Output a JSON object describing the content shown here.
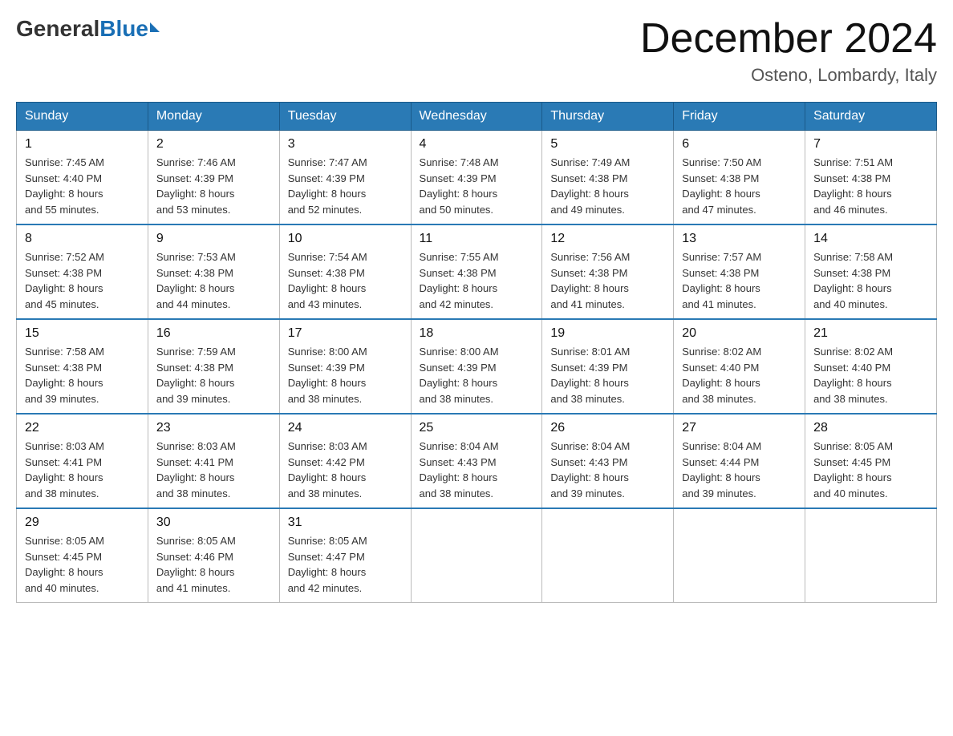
{
  "header": {
    "logo_general": "General",
    "logo_blue": "Blue",
    "month_year": "December 2024",
    "location": "Osteno, Lombardy, Italy"
  },
  "days_of_week": [
    "Sunday",
    "Monday",
    "Tuesday",
    "Wednesday",
    "Thursday",
    "Friday",
    "Saturday"
  ],
  "weeks": [
    [
      {
        "day": "1",
        "sunrise": "7:45 AM",
        "sunset": "4:40 PM",
        "daylight": "8 hours and 55 minutes."
      },
      {
        "day": "2",
        "sunrise": "7:46 AM",
        "sunset": "4:39 PM",
        "daylight": "8 hours and 53 minutes."
      },
      {
        "day": "3",
        "sunrise": "7:47 AM",
        "sunset": "4:39 PM",
        "daylight": "8 hours and 52 minutes."
      },
      {
        "day": "4",
        "sunrise": "7:48 AM",
        "sunset": "4:39 PM",
        "daylight": "8 hours and 50 minutes."
      },
      {
        "day": "5",
        "sunrise": "7:49 AM",
        "sunset": "4:38 PM",
        "daylight": "8 hours and 49 minutes."
      },
      {
        "day": "6",
        "sunrise": "7:50 AM",
        "sunset": "4:38 PM",
        "daylight": "8 hours and 47 minutes."
      },
      {
        "day": "7",
        "sunrise": "7:51 AM",
        "sunset": "4:38 PM",
        "daylight": "8 hours and 46 minutes."
      }
    ],
    [
      {
        "day": "8",
        "sunrise": "7:52 AM",
        "sunset": "4:38 PM",
        "daylight": "8 hours and 45 minutes."
      },
      {
        "day": "9",
        "sunrise": "7:53 AM",
        "sunset": "4:38 PM",
        "daylight": "8 hours and 44 minutes."
      },
      {
        "day": "10",
        "sunrise": "7:54 AM",
        "sunset": "4:38 PM",
        "daylight": "8 hours and 43 minutes."
      },
      {
        "day": "11",
        "sunrise": "7:55 AM",
        "sunset": "4:38 PM",
        "daylight": "8 hours and 42 minutes."
      },
      {
        "day": "12",
        "sunrise": "7:56 AM",
        "sunset": "4:38 PM",
        "daylight": "8 hours and 41 minutes."
      },
      {
        "day": "13",
        "sunrise": "7:57 AM",
        "sunset": "4:38 PM",
        "daylight": "8 hours and 41 minutes."
      },
      {
        "day": "14",
        "sunrise": "7:58 AM",
        "sunset": "4:38 PM",
        "daylight": "8 hours and 40 minutes."
      }
    ],
    [
      {
        "day": "15",
        "sunrise": "7:58 AM",
        "sunset": "4:38 PM",
        "daylight": "8 hours and 39 minutes."
      },
      {
        "day": "16",
        "sunrise": "7:59 AM",
        "sunset": "4:38 PM",
        "daylight": "8 hours and 39 minutes."
      },
      {
        "day": "17",
        "sunrise": "8:00 AM",
        "sunset": "4:39 PM",
        "daylight": "8 hours and 38 minutes."
      },
      {
        "day": "18",
        "sunrise": "8:00 AM",
        "sunset": "4:39 PM",
        "daylight": "8 hours and 38 minutes."
      },
      {
        "day": "19",
        "sunrise": "8:01 AM",
        "sunset": "4:39 PM",
        "daylight": "8 hours and 38 minutes."
      },
      {
        "day": "20",
        "sunrise": "8:02 AM",
        "sunset": "4:40 PM",
        "daylight": "8 hours and 38 minutes."
      },
      {
        "day": "21",
        "sunrise": "8:02 AM",
        "sunset": "4:40 PM",
        "daylight": "8 hours and 38 minutes."
      }
    ],
    [
      {
        "day": "22",
        "sunrise": "8:03 AM",
        "sunset": "4:41 PM",
        "daylight": "8 hours and 38 minutes."
      },
      {
        "day": "23",
        "sunrise": "8:03 AM",
        "sunset": "4:41 PM",
        "daylight": "8 hours and 38 minutes."
      },
      {
        "day": "24",
        "sunrise": "8:03 AM",
        "sunset": "4:42 PM",
        "daylight": "8 hours and 38 minutes."
      },
      {
        "day": "25",
        "sunrise": "8:04 AM",
        "sunset": "4:43 PM",
        "daylight": "8 hours and 38 minutes."
      },
      {
        "day": "26",
        "sunrise": "8:04 AM",
        "sunset": "4:43 PM",
        "daylight": "8 hours and 39 minutes."
      },
      {
        "day": "27",
        "sunrise": "8:04 AM",
        "sunset": "4:44 PM",
        "daylight": "8 hours and 39 minutes."
      },
      {
        "day": "28",
        "sunrise": "8:05 AM",
        "sunset": "4:45 PM",
        "daylight": "8 hours and 40 minutes."
      }
    ],
    [
      {
        "day": "29",
        "sunrise": "8:05 AM",
        "sunset": "4:45 PM",
        "daylight": "8 hours and 40 minutes."
      },
      {
        "day": "30",
        "sunrise": "8:05 AM",
        "sunset": "4:46 PM",
        "daylight": "8 hours and 41 minutes."
      },
      {
        "day": "31",
        "sunrise": "8:05 AM",
        "sunset": "4:47 PM",
        "daylight": "8 hours and 42 minutes."
      },
      null,
      null,
      null,
      null
    ]
  ],
  "labels": {
    "sunrise": "Sunrise:",
    "sunset": "Sunset:",
    "daylight": "Daylight:"
  }
}
